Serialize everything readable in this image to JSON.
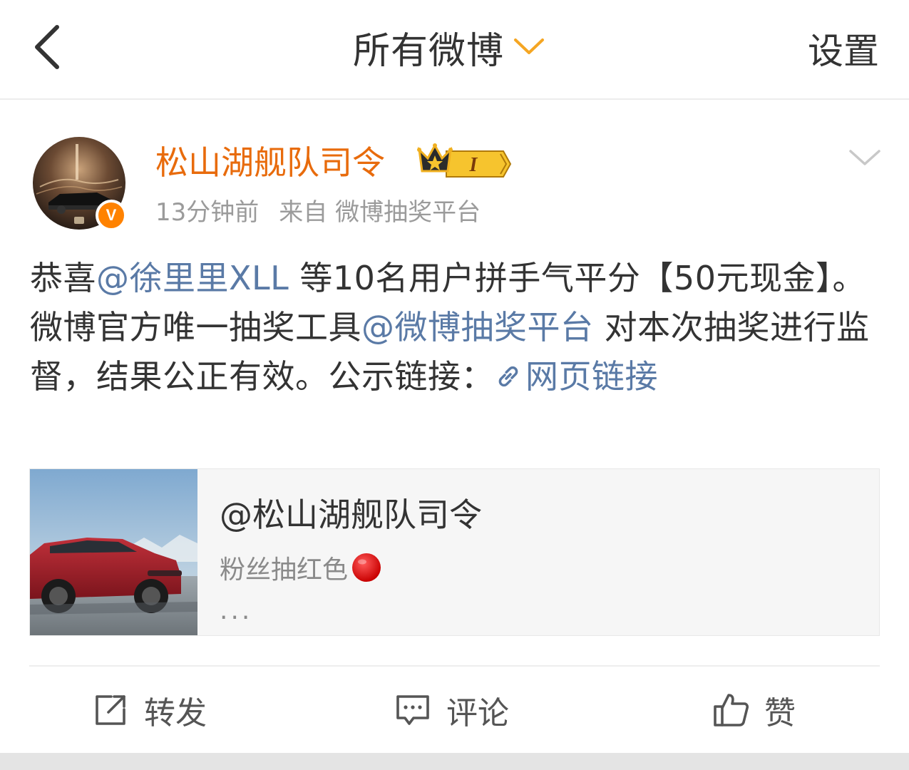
{
  "nav": {
    "back_icon": "chevron-left-icon",
    "title": "所有微博",
    "title_chevron_icon": "chevron-down-icon",
    "title_chevron_color": "#f5a623",
    "settings_label": "设置"
  },
  "post": {
    "author": {
      "name": "松山湖舰队司令",
      "name_color": "#e86b0c",
      "avatar_icon": "avatar",
      "verified_badge": "V",
      "member_badge_icon": "crown-member-badge-icon",
      "member_level": "I"
    },
    "time": "13分钟前",
    "source": "来自 微博抽奖平台",
    "more_icon": "chevron-down-icon",
    "body": {
      "prefix": "恭喜",
      "mention1": "@徐里里XLL",
      "part2": " 等10名用户拼手气平分【50元现金】。微博官方唯一抽奖工具",
      "mention2": "@微博抽奖平台",
      "part3": " 对本次抽奖进行监督，结果公正有效。公示链接：",
      "link_icon": "link-icon",
      "link_text": "网页链接"
    },
    "card": {
      "thumbnail": "red-suv-image",
      "title": "@松山湖舰队司令",
      "description": "粉丝抽红色",
      "emoji": "red-circle-icon",
      "ellipsis": "..."
    },
    "actions": {
      "repost_icon": "share-out-icon",
      "repost_label": "转发",
      "comment_icon": "comment-icon",
      "comment_label": "评论",
      "like_icon": "thumbs-up-icon",
      "like_label": "赞"
    }
  },
  "colors": {
    "link": "#5a7aa6",
    "accent_orange": "#ff8200",
    "text": "#333333",
    "meta": "#9b9b9b"
  }
}
